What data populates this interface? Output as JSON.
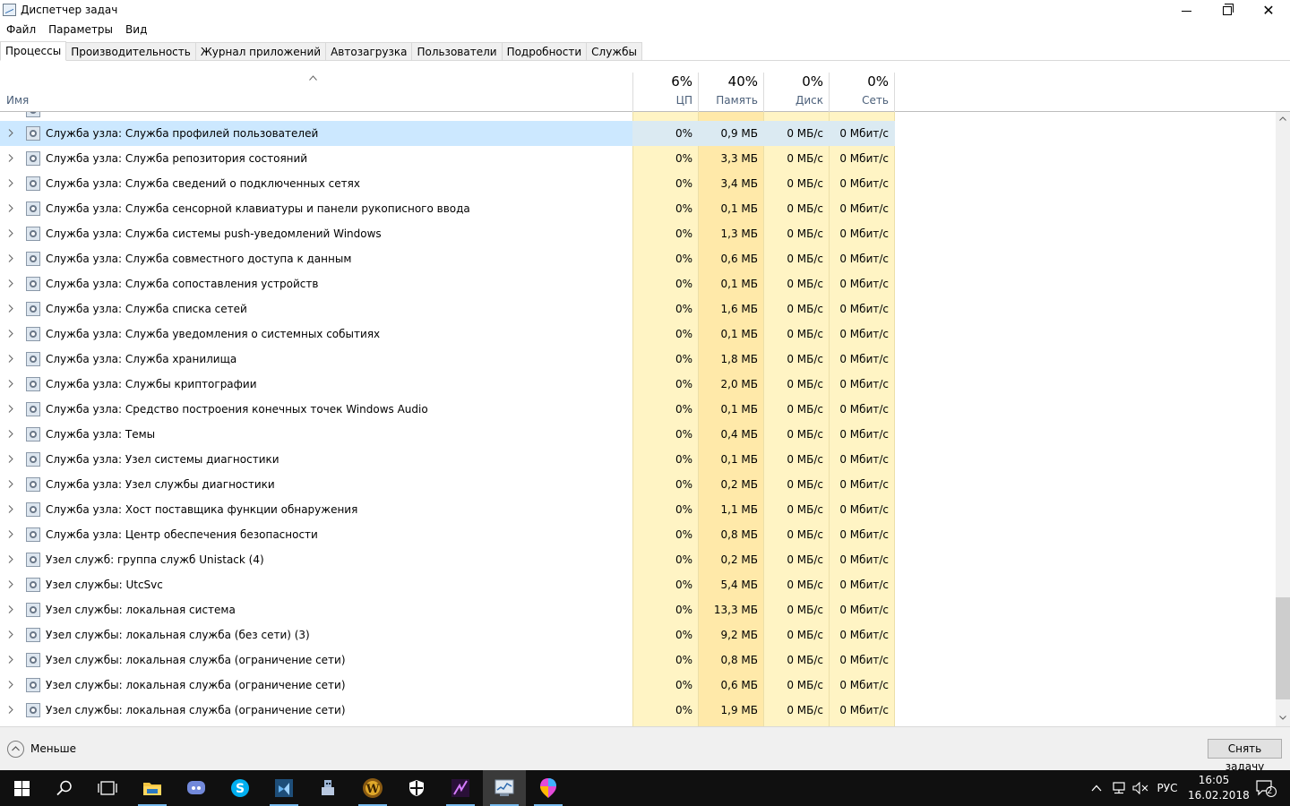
{
  "window": {
    "title": "Диспетчер задач",
    "icon": "task-manager-icon"
  },
  "menu": [
    {
      "label": "Файл"
    },
    {
      "label": "Параметры"
    },
    {
      "label": "Вид"
    }
  ],
  "tabs": [
    {
      "label": "Процессы",
      "active": true
    },
    {
      "label": "Производительность"
    },
    {
      "label": "Журнал приложений"
    },
    {
      "label": "Автозагрузка"
    },
    {
      "label": "Пользователи"
    },
    {
      "label": "Подробности"
    },
    {
      "label": "Службы"
    }
  ],
  "columns": {
    "name": "Имя",
    "cpu": {
      "percent": "6%",
      "label": "ЦП"
    },
    "memory": {
      "percent": "40%",
      "label": "Память"
    },
    "disk": {
      "percent": "0%",
      "label": "Диск"
    },
    "network": {
      "percent": "0%",
      "label": "Сеть"
    }
  },
  "colors": {
    "heat_light": "#fff4c4",
    "heat_medium": "#ffe9a9",
    "selection": "#cce8ff"
  },
  "processes": [
    {
      "name": "Служба узла: Служба профилей пользователей",
      "cpu": "0%",
      "memory": "0,9 МБ",
      "disk": "0 МБ/с",
      "network": "0 Мбит/с",
      "selected": true
    },
    {
      "name": "Служба узла: Служба репозитория состояний",
      "cpu": "0%",
      "memory": "3,3 МБ",
      "disk": "0 МБ/с",
      "network": "0 Мбит/с"
    },
    {
      "name": "Служба узла: Служба сведений о подключенных сетях",
      "cpu": "0%",
      "memory": "3,4 МБ",
      "disk": "0 МБ/с",
      "network": "0 Мбит/с"
    },
    {
      "name": "Служба узла: Служба сенсорной клавиатуры и панели рукописного ввода",
      "cpu": "0%",
      "memory": "0,1 МБ",
      "disk": "0 МБ/с",
      "network": "0 Мбит/с"
    },
    {
      "name": "Служба узла: Служба системы push-уведомлений Windows",
      "cpu": "0%",
      "memory": "1,3 МБ",
      "disk": "0 МБ/с",
      "network": "0 Мбит/с"
    },
    {
      "name": "Служба узла: Служба совместного доступа к данным",
      "cpu": "0%",
      "memory": "0,6 МБ",
      "disk": "0 МБ/с",
      "network": "0 Мбит/с"
    },
    {
      "name": "Служба узла: Служба сопоставления устройств",
      "cpu": "0%",
      "memory": "0,1 МБ",
      "disk": "0 МБ/с",
      "network": "0 Мбит/с"
    },
    {
      "name": "Служба узла: Служба списка сетей",
      "cpu": "0%",
      "memory": "1,6 МБ",
      "disk": "0 МБ/с",
      "network": "0 Мбит/с"
    },
    {
      "name": "Служба узла: Служба уведомления о системных событиях",
      "cpu": "0%",
      "memory": "0,1 МБ",
      "disk": "0 МБ/с",
      "network": "0 Мбит/с"
    },
    {
      "name": "Служба узла: Служба хранилища",
      "cpu": "0%",
      "memory": "1,8 МБ",
      "disk": "0 МБ/с",
      "network": "0 Мбит/с"
    },
    {
      "name": "Служба узла: Службы криптографии",
      "cpu": "0%",
      "memory": "2,0 МБ",
      "disk": "0 МБ/с",
      "network": "0 Мбит/с"
    },
    {
      "name": "Служба узла: Средство построения конечных точек Windows Audio",
      "cpu": "0%",
      "memory": "0,1 МБ",
      "disk": "0 МБ/с",
      "network": "0 Мбит/с"
    },
    {
      "name": "Служба узла: Темы",
      "cpu": "0%",
      "memory": "0,4 МБ",
      "disk": "0 МБ/с",
      "network": "0 Мбит/с"
    },
    {
      "name": "Служба узла: Узел системы диагностики",
      "cpu": "0%",
      "memory": "0,1 МБ",
      "disk": "0 МБ/с",
      "network": "0 Мбит/с"
    },
    {
      "name": "Служба узла: Узел службы диагностики",
      "cpu": "0%",
      "memory": "0,2 МБ",
      "disk": "0 МБ/с",
      "network": "0 Мбит/с"
    },
    {
      "name": "Служба узла: Хост поставщика функции обнаружения",
      "cpu": "0%",
      "memory": "1,1 МБ",
      "disk": "0 МБ/с",
      "network": "0 Мбит/с"
    },
    {
      "name": "Служба узла: Центр обеспечения безопасности",
      "cpu": "0%",
      "memory": "0,8 МБ",
      "disk": "0 МБ/с",
      "network": "0 Мбит/с"
    },
    {
      "name": "Узел служб: группа служб Unistack (4)",
      "cpu": "0%",
      "memory": "0,2 МБ",
      "disk": "0 МБ/с",
      "network": "0 Мбит/с"
    },
    {
      "name": "Узел службы: UtcSvc",
      "cpu": "0%",
      "memory": "5,4 МБ",
      "disk": "0 МБ/с",
      "network": "0 Мбит/с"
    },
    {
      "name": "Узел службы: локальная система",
      "cpu": "0%",
      "memory": "13,3 МБ",
      "disk": "0 МБ/с",
      "network": "0 Мбит/с"
    },
    {
      "name": "Узел службы: локальная служба (без сети) (3)",
      "cpu": "0%",
      "memory": "9,2 МБ",
      "disk": "0 МБ/с",
      "network": "0 Мбит/с"
    },
    {
      "name": "Узел службы: локальная служба (ограничение сети)",
      "cpu": "0%",
      "memory": "0,8 МБ",
      "disk": "0 МБ/с",
      "network": "0 Мбит/с"
    },
    {
      "name": "Узел службы: локальная служба (ограничение сети)",
      "cpu": "0%",
      "memory": "0,6 МБ",
      "disk": "0 МБ/с",
      "network": "0 Мбит/с"
    },
    {
      "name": "Узел службы: локальная служба (ограничение сети)",
      "cpu": "0%",
      "memory": "1,9 МБ",
      "disk": "0 МБ/с",
      "network": "0 Мбит/с"
    }
  ],
  "footer": {
    "less_label": "Меньше",
    "end_task_label": "Снять задачу"
  },
  "taskbar": {
    "apps": [
      {
        "icon": "start-windows-icon"
      },
      {
        "icon": "search-icon"
      },
      {
        "icon": "task-view-icon"
      },
      {
        "icon": "file-explorer-icon"
      },
      {
        "icon": "discord-icon"
      },
      {
        "icon": "skype-icon"
      },
      {
        "icon": "visual-studio-icon"
      },
      {
        "icon": "game-character-icon"
      },
      {
        "icon": "warcraft-icon"
      },
      {
        "icon": "windows-defender-icon"
      },
      {
        "icon": "purple-app-icon"
      },
      {
        "icon": "task-manager-icon"
      },
      {
        "icon": "paint-3d-icon"
      }
    ],
    "tray": {
      "language": "РУС",
      "time": "16:05",
      "date": "16.02.2018",
      "notifications": "2"
    }
  }
}
